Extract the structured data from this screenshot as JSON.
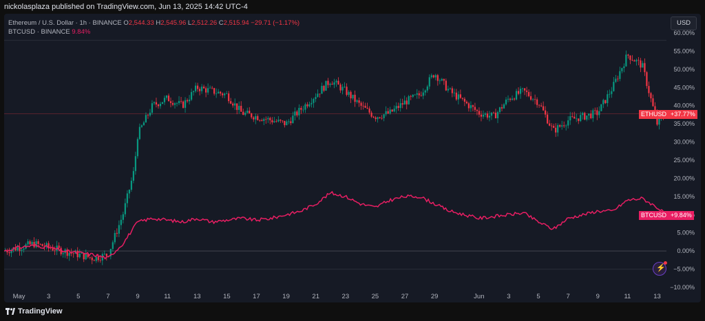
{
  "header": {
    "published_text": "nickolasplaza published on TradingView.com, Jun 13, 2025 14:42 UTC-4"
  },
  "legend": {
    "eth_symbol": "Ethereum / U.S. Dollar · 1h · BINANCE",
    "o_label": "O",
    "o_value": "2,544.33",
    "h_label": "H",
    "h_value": "2,545.96",
    "l_label": "L",
    "l_value": "2,512.26",
    "c_label": "C",
    "c_value": "2,515.94",
    "change": "−29.71 (−1.17%)",
    "btc_symbol": "BTCUSD · BINANCE",
    "btc_value": "9.84%"
  },
  "currency_button": "USD",
  "tags": {
    "eth_name": "ETHUSD",
    "eth_value": "+37.77%",
    "btc_name": "BTCUSD",
    "btc_value": "+9.84%"
  },
  "footer": {
    "brand": "TradingView"
  },
  "colors": {
    "up": "#089981",
    "down": "#f23645",
    "btc_line": "#e91e63"
  },
  "icons": [
    "lightning-icon",
    "tradingview-logo-icon"
  ],
  "chart_data": {
    "type": "line",
    "y_unit": "percent change",
    "ylim": [
      -10,
      60
    ],
    "y_ticks": [
      "60.00%",
      "55.00%",
      "50.00%",
      "45.00%",
      "40.00%",
      "35.00%",
      "30.00%",
      "25.00%",
      "20.00%",
      "15.00%",
      "10.00%",
      "5.00%",
      "0.00%",
      "−5.00%",
      "−10.00%"
    ],
    "y_tick_values": [
      60,
      55,
      50,
      45,
      40,
      35,
      30,
      25,
      20,
      15,
      10,
      5,
      0,
      -5,
      -10
    ],
    "x_ticks": [
      "May",
      "3",
      "5",
      "7",
      "9",
      "11",
      "13",
      "15",
      "17",
      "19",
      "21",
      "23",
      "25",
      "27",
      "29",
      "Jun",
      "3",
      "5",
      "7",
      "9",
      "11",
      "13"
    ],
    "x_tick_dates": [
      "2025-05-01",
      "2025-05-03",
      "2025-05-05",
      "2025-05-07",
      "2025-05-09",
      "2025-05-11",
      "2025-05-13",
      "2025-05-15",
      "2025-05-17",
      "2025-05-19",
      "2025-05-21",
      "2025-05-23",
      "2025-05-25",
      "2025-05-27",
      "2025-05-29",
      "2025-06-01",
      "2025-06-03",
      "2025-06-05",
      "2025-06-07",
      "2025-06-09",
      "2025-06-11",
      "2025-06-13"
    ],
    "x_range": [
      "2025-04-30",
      "2025-06-13T15:00"
    ],
    "series": [
      {
        "name": "ETHUSD",
        "style": "candles",
        "x": [
          "2025-04-30",
          "2025-05-01",
          "2025-05-02",
          "2025-05-03",
          "2025-05-04",
          "2025-05-05",
          "2025-05-06",
          "2025-05-07",
          "2025-05-08",
          "2025-05-08T18:00",
          "2025-05-09",
          "2025-05-10",
          "2025-05-11",
          "2025-05-12",
          "2025-05-13",
          "2025-05-14",
          "2025-05-15",
          "2025-05-16",
          "2025-05-17",
          "2025-05-18",
          "2025-05-19",
          "2025-05-20",
          "2025-05-21",
          "2025-05-22",
          "2025-05-23",
          "2025-05-24",
          "2025-05-25",
          "2025-05-26",
          "2025-05-27",
          "2025-05-28",
          "2025-05-29",
          "2025-05-30",
          "2025-05-31",
          "2025-06-01",
          "2025-06-02",
          "2025-06-03",
          "2025-06-04",
          "2025-06-05",
          "2025-06-06",
          "2025-06-07",
          "2025-06-08",
          "2025-06-09",
          "2025-06-10",
          "2025-06-11",
          "2025-06-12",
          "2025-06-13",
          "2025-06-13T15:00"
        ],
        "values": [
          0,
          1,
          2,
          1,
          0,
          -1,
          -2,
          -1,
          10,
          22,
          32,
          40,
          42,
          40,
          45,
          44,
          43,
          38,
          37,
          36,
          35,
          39,
          43,
          47,
          44,
          40,
          37,
          38,
          41,
          43,
          49,
          44,
          41,
          38,
          37,
          42,
          44,
          41,
          33,
          36,
          37,
          38,
          45,
          54,
          51,
          35,
          38
        ]
      },
      {
        "name": "BTCUSD",
        "style": "line",
        "x": [
          "2025-04-30",
          "2025-05-01",
          "2025-05-02",
          "2025-05-03",
          "2025-05-04",
          "2025-05-05",
          "2025-05-06",
          "2025-05-07",
          "2025-05-08",
          "2025-05-09",
          "2025-05-10",
          "2025-05-11",
          "2025-05-12",
          "2025-05-13",
          "2025-05-14",
          "2025-05-15",
          "2025-05-16",
          "2025-05-17",
          "2025-05-18",
          "2025-05-19",
          "2025-05-20",
          "2025-05-21",
          "2025-05-22",
          "2025-05-23",
          "2025-05-24",
          "2025-05-25",
          "2025-05-26",
          "2025-05-27",
          "2025-05-28",
          "2025-05-29",
          "2025-05-30",
          "2025-05-31",
          "2025-06-01",
          "2025-06-02",
          "2025-06-03",
          "2025-06-04",
          "2025-06-05",
          "2025-06-06",
          "2025-06-07",
          "2025-06-08",
          "2025-06-09",
          "2025-06-10",
          "2025-06-11",
          "2025-06-12",
          "2025-06-13",
          "2025-06-13T15:00"
        ],
        "values": [
          0,
          1,
          1.5,
          1,
          0,
          -0.5,
          -1,
          -2,
          2,
          8,
          9,
          8.5,
          8,
          9,
          8,
          8.5,
          9,
          8.5,
          9,
          10,
          11,
          13,
          16,
          15,
          13,
          12,
          14,
          15,
          15,
          13,
          11,
          10,
          9,
          9.5,
          10,
          10.5,
          8,
          6,
          9,
          10,
          11,
          11,
          14,
          14.5,
          12,
          9.84
        ]
      }
    ],
    "reference_lines": [
      {
        "series": "ETHUSD",
        "value": 37.77
      },
      {
        "series": "BTCUSD",
        "value": 9.84
      }
    ]
  }
}
